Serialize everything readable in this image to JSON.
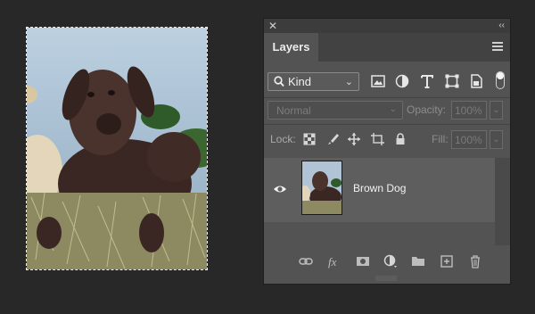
{
  "panel": {
    "close_glyph": "✕",
    "collapse_glyph": "‹‹",
    "tab_label": "Layers",
    "menu_icon": "hamburger-menu-icon"
  },
  "filter": {
    "kind_label": "Kind",
    "icons": [
      "pixel-filter-icon",
      "adjustment-filter-icon",
      "type-filter-icon",
      "shape-filter-icon",
      "smart-object-filter-icon"
    ],
    "toggle_on": true
  },
  "blend": {
    "mode": "Normal",
    "opacity_label": "Opacity:",
    "opacity_value": "100%"
  },
  "lock": {
    "label": "Lock:",
    "icons": [
      "lock-transparent-icon",
      "lock-pixels-icon",
      "lock-position-icon",
      "lock-artboard-icon",
      "lock-all-icon"
    ],
    "fill_label": "Fill:",
    "fill_value": "100%"
  },
  "layers": [
    {
      "name": "Brown Dog",
      "visible": true
    }
  ],
  "bottom_icons": [
    "link-layers-icon",
    "fx-icon",
    "add-mask-icon",
    "adjustment-layer-icon",
    "new-group-icon",
    "new-layer-icon",
    "delete-icon"
  ],
  "colors": {
    "panel": "#535353",
    "background": "#282828",
    "layer_row": "#5e5e5e"
  }
}
